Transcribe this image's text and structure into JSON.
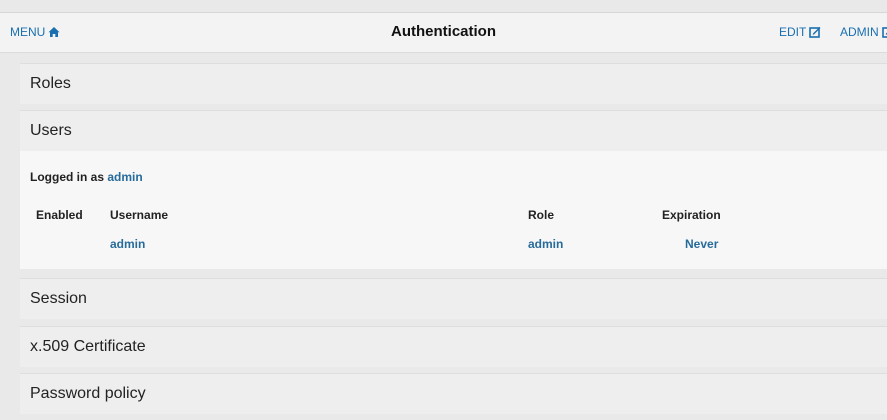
{
  "topbar": {
    "menu_label": "MENU",
    "title": "Authentication",
    "edit_label": "EDIT",
    "admin_label": "ADMIN"
  },
  "panels": {
    "roles": "Roles",
    "users": "Users",
    "session": "Session",
    "x509": "x.509 Certificate",
    "password_policy": "Password policy"
  },
  "users": {
    "logged_in_prefix": "Logged in as",
    "logged_in_user": "admin",
    "columns": [
      "Enabled",
      "Username",
      "Role",
      "Expiration"
    ],
    "rows": [
      {
        "enabled": "",
        "username": "admin",
        "role": "admin",
        "expiration": "Never"
      }
    ]
  },
  "colors": {
    "link": "#1a6fb0",
    "cell": "#276b9a"
  },
  "icons": {
    "menu": "home-icon",
    "edit": "edit-icon",
    "admin": "edit-icon"
  }
}
